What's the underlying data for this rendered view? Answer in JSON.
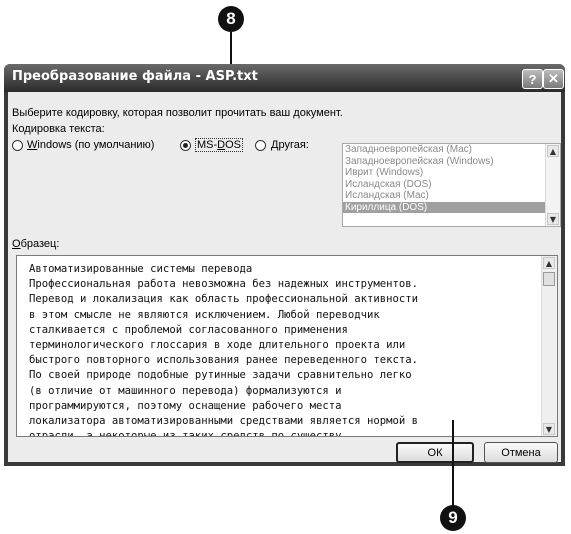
{
  "callouts": {
    "top": "8",
    "bottom": "9"
  },
  "dialog": {
    "title": "Преобразование файла - ASP.txt",
    "help_glyph": "?",
    "close_glyph": "✕",
    "instruction": "Выберите кодировку, которая позволит прочитать ваш документ.",
    "encoding_label": "Кодировка текста:",
    "radio_windows": {
      "accel": "W",
      "rest": "indows (по умолчанию)",
      "selected": false
    },
    "radio_msdos": {
      "pre": "MS-",
      "accel": "D",
      "rest": "OS",
      "selected": true
    },
    "radio_other": {
      "accel": "Д",
      "rest": "ругая:",
      "selected": false
    },
    "encodings": [
      "Западноевропейская (Mac)",
      "Западноевропейская (Windows)",
      "Иврит (Windows)",
      "Исландская (DOS)",
      "Исландская (Mac)",
      "Кириллица (DOS)"
    ],
    "encodings_selected_index": 5,
    "sample_label": {
      "accel": "О",
      "rest": "бразец:"
    },
    "sample_lines": [
      "Автоматизированные системы перевода",
      "Профессиональная работа невозможна без надежных инструментов.",
      "Перевод и локализация как область профессиональной активности",
      "в этом смысле не являются исключением. Любой переводчик",
      "сталкивается с проблемой согласованного применения",
      "терминологического глоссария в ходе длительного проекта или",
      "быстрого повторного использования ранее переведенного текста.",
      "По своей природе подобные рутинные задачи сравнительно легко",
      "(в отличие от машинного перевода) формализуются и",
      "программируются, поэтому оснащение рабочего места",
      "локализатора автоматизированными средствами является нормой в",
      "отрасли, а некоторые из таких средств по существу"
    ],
    "ok_label": "ОК",
    "cancel_label": "Отмена"
  },
  "icons": {
    "scroll_up": "▲",
    "scroll_down": "▼"
  }
}
